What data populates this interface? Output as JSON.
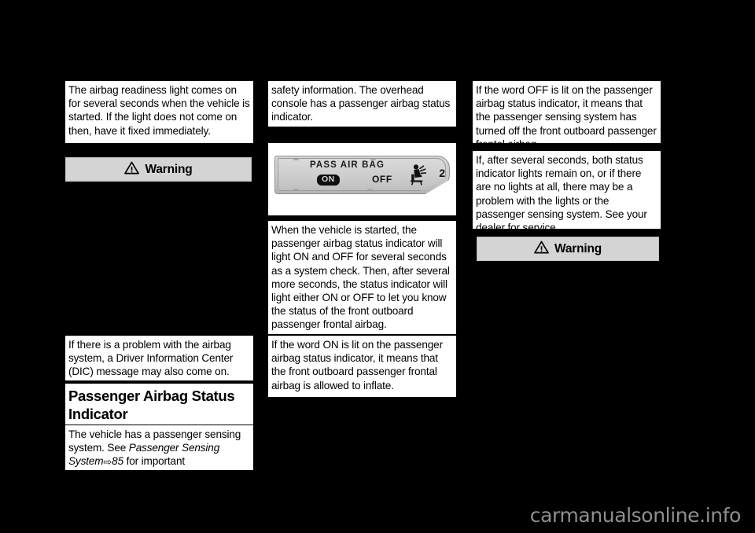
{
  "page": {
    "background_color": "#000000",
    "text_block_color": "#ffffff",
    "warning_banner_color": "#d4d4d4",
    "watermark": "carmanualsonline.info",
    "watermark_color": "#8f8f8f"
  },
  "column_1": {
    "paragraph_1": "The airbag readiness light comes on for several seconds when the vehicle is started. If the light does not come on then, have it fixed immediately.",
    "warning_1_label": "Warning",
    "warning_1_icon": "warning-triangle-icon",
    "paragraph_2": "If there is a problem with the airbag system, a Driver Information Center (DIC) message may also come on.",
    "heading": "Passenger Airbag Status Indicator",
    "paragraph_3_part1": "The vehicle has a passenger sensing system. See ",
    "paragraph_3_italic1": "Passenger Sensing System",
    "paragraph_3_arrow": "⇨",
    "paragraph_3_italic2": "85",
    "paragraph_3_part2": " for important"
  },
  "column_2": {
    "paragraph_1": "safety information. The overhead console has a passenger airbag status indicator.",
    "figure": {
      "name": "overhead-console-passenger-airbag-status-indicator",
      "title_text": "PASS AIR BAG",
      "on_label": "ON",
      "on_state": "lit",
      "off_label": "OFF",
      "occupant_icon": "passenger-airbag-seat-icon",
      "occupant_number": "2"
    },
    "paragraph_2": "When the vehicle is started, the passenger airbag status indicator will light ON and OFF for several seconds as a system check. Then, after several more seconds, the status indicator will light either ON or OFF to let you know the status of the front outboard passenger frontal airbag.",
    "paragraph_3": "If the word ON is lit on the passenger airbag status indicator, it means that the front outboard passenger frontal airbag is allowed to inflate."
  },
  "column_3": {
    "paragraph_1": "If the word OFF is lit on the passenger airbag status indicator, it means that the passenger sensing system has turned off the front outboard passenger frontal airbag.",
    "paragraph_2": "If, after several seconds, both status indicator lights remain on, or if there are no lights at all, there may be a problem with the lights or the passenger sensing system. See your dealer for service.",
    "warning_1_label": "Warning",
    "warning_1_icon": "warning-triangle-icon"
  }
}
